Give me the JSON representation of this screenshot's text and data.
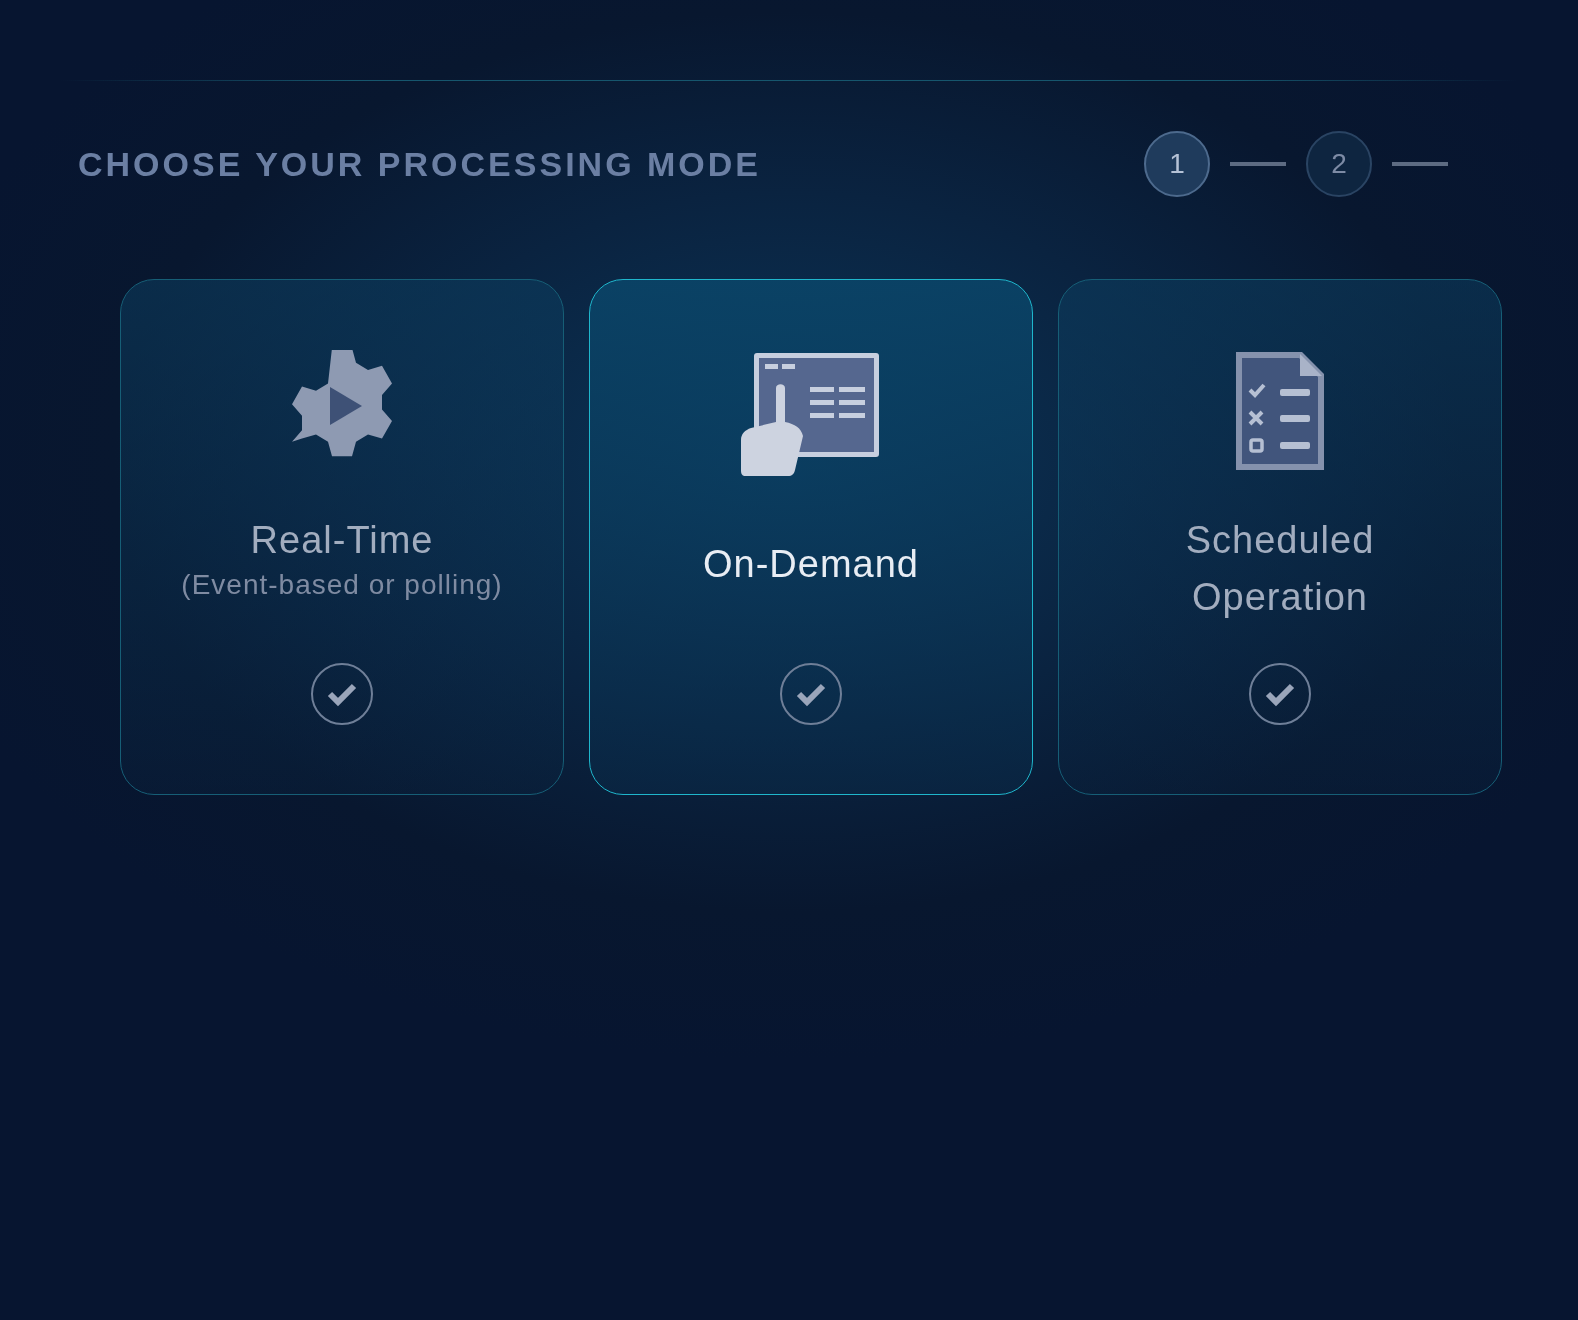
{
  "heading": "CHOOSE YOUR PROCESSING MODE",
  "steps": [
    {
      "label": "1",
      "selected": true
    },
    {
      "label": "2",
      "selected": false
    }
  ],
  "modes": [
    {
      "kind": "gear",
      "title": "Real-Time",
      "subtitle": "(Event-based or polling)",
      "selected": false
    },
    {
      "kind": "touch",
      "title": "On-Demand",
      "selected": true
    },
    {
      "kind": "checklist",
      "title": "Scheduled Operation",
      "selected": false
    }
  ]
}
